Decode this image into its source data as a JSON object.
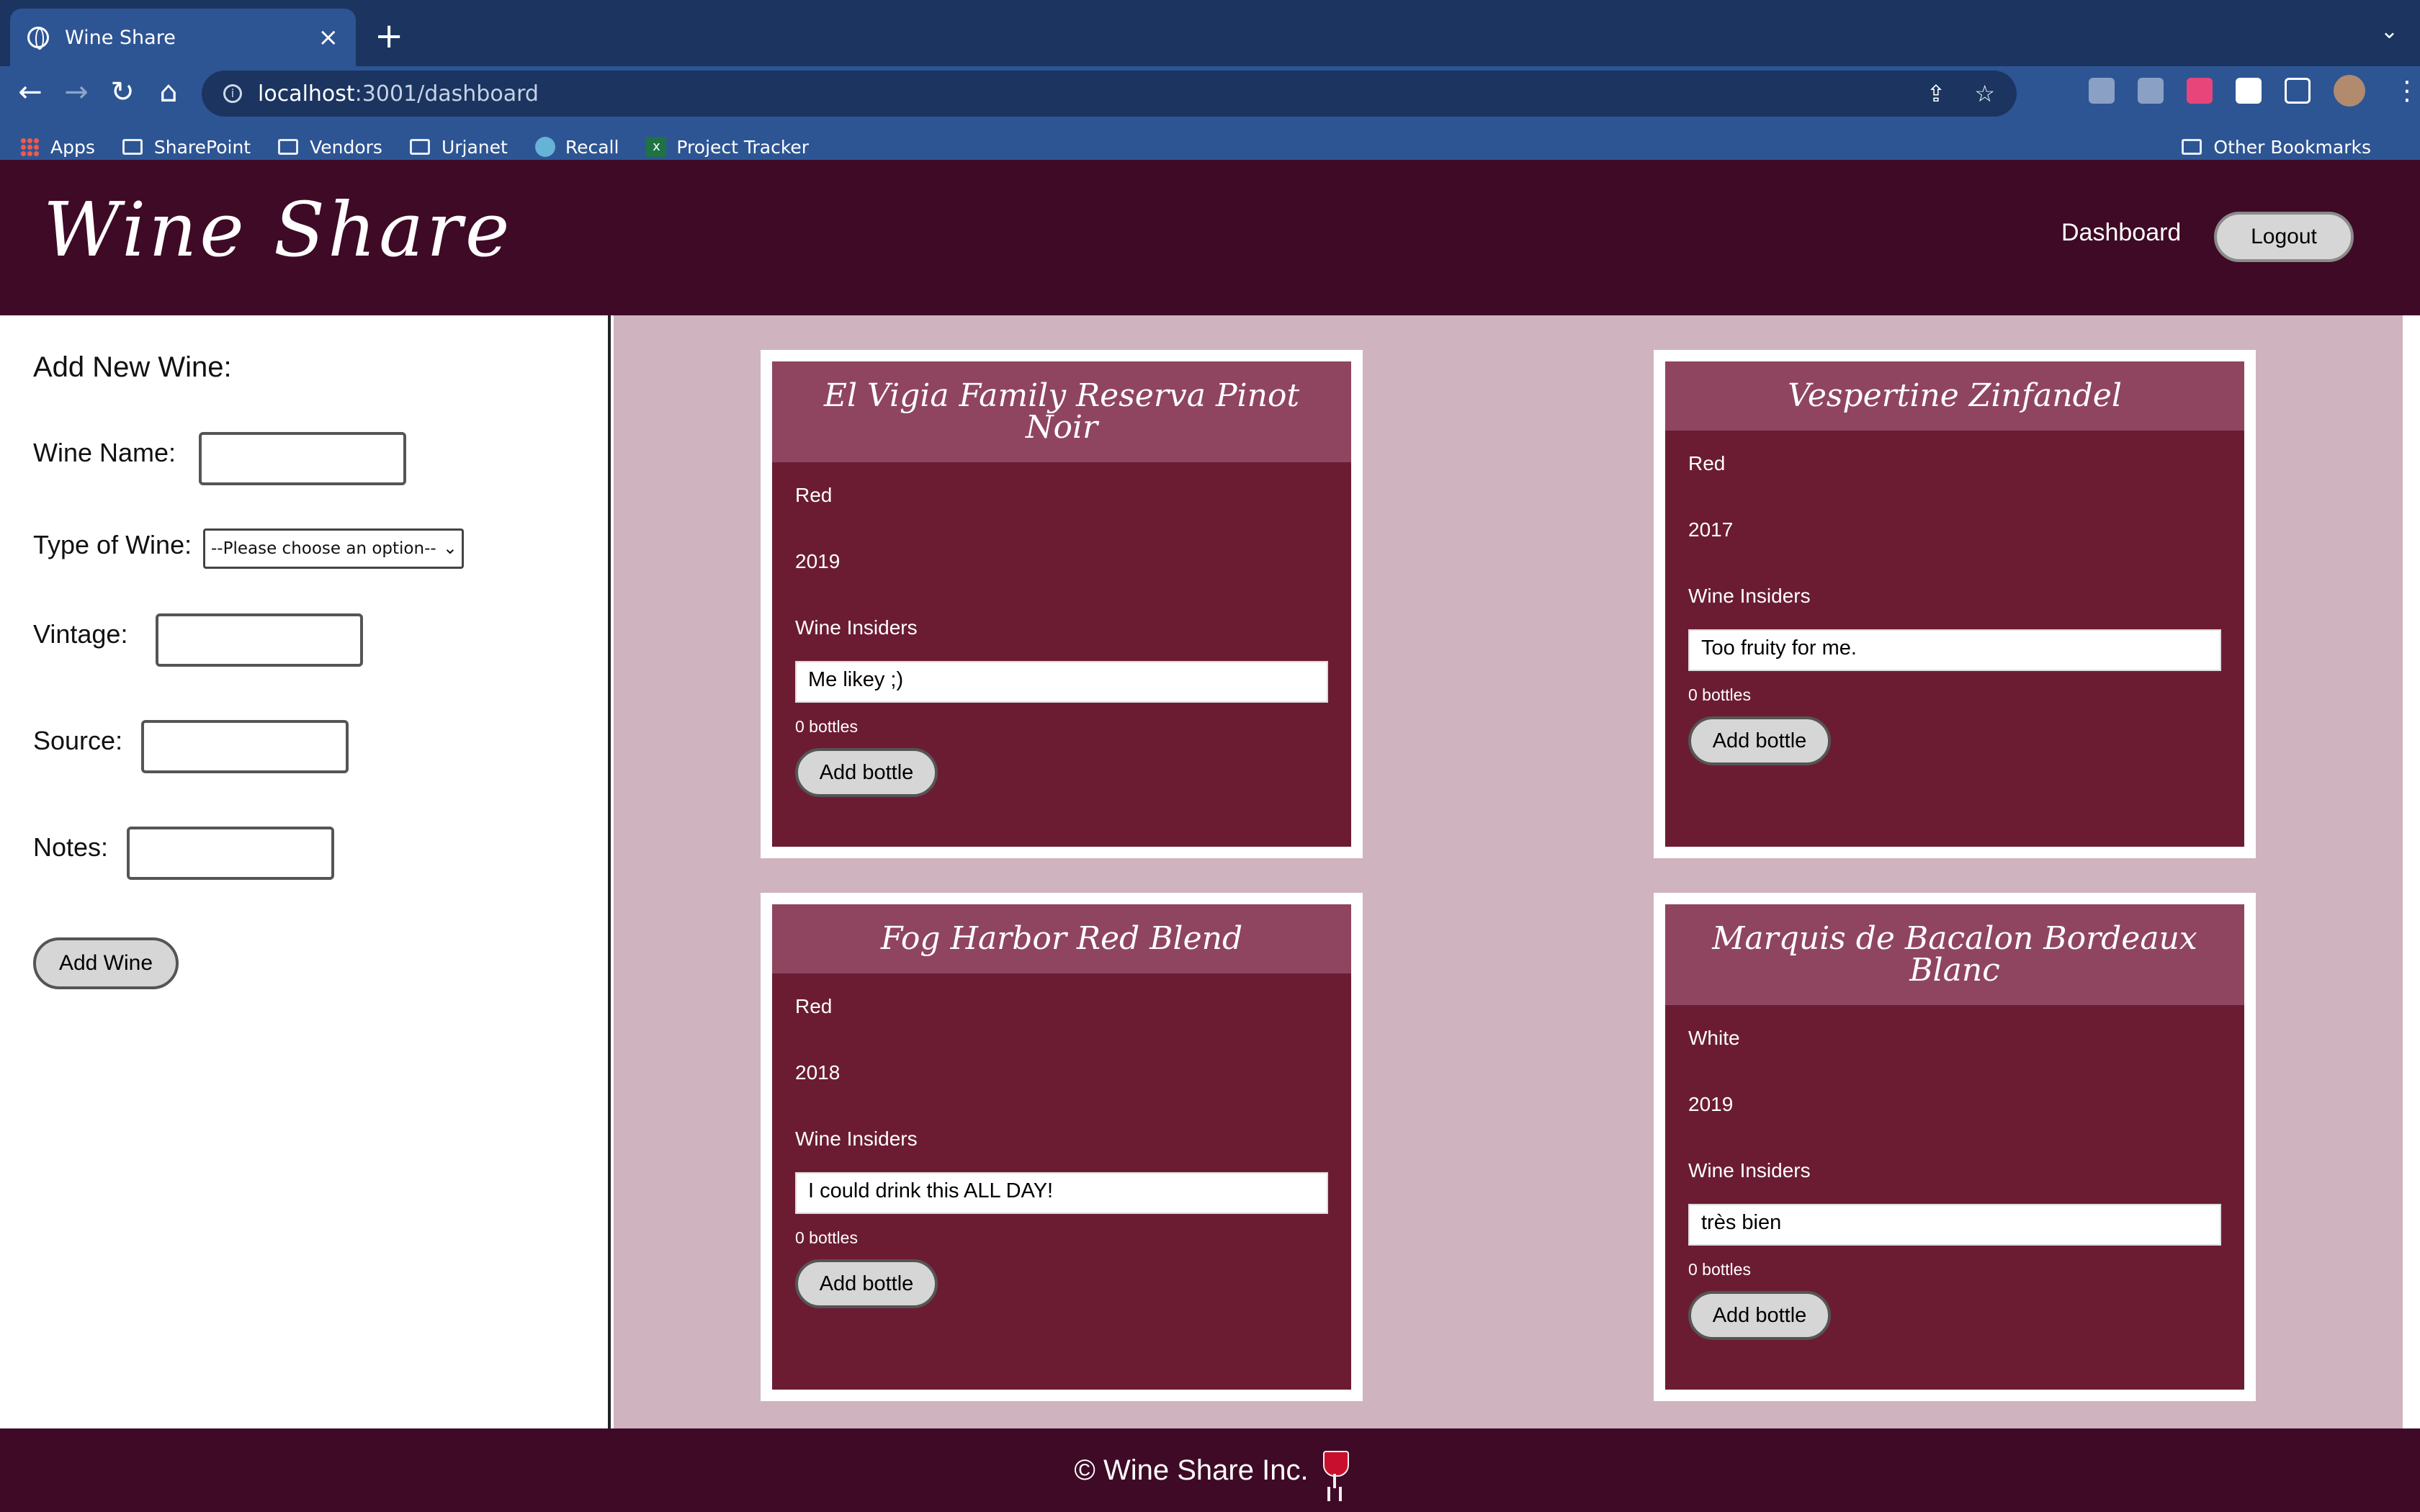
{
  "browser": {
    "tab_title": "Wine Share",
    "url_host": "localhost",
    "url_path": ":3001/dashboard",
    "bookmarks": [
      "Apps",
      "SharePoint",
      "Vendors",
      "Urjanet",
      "Recall",
      "Project Tracker"
    ],
    "other_bookmarks": "Other Bookmarks"
  },
  "header": {
    "logo": "Wine Share",
    "nav_dashboard": "Dashboard",
    "logout_label": "Logout"
  },
  "form": {
    "title": "Add New Wine:",
    "wine_name_label": "Wine Name:",
    "wine_name_value": "",
    "type_label": "Type of Wine:",
    "type_value": "--Please choose an option--",
    "vintage_label": "Vintage:",
    "vintage_value": "",
    "source_label": "Source:",
    "source_value": "",
    "notes_label": "Notes:",
    "notes_value": "",
    "submit_label": "Add Wine"
  },
  "wines": [
    {
      "name": "El Vigia Family Reserva Pinot Noir",
      "type": "Red",
      "vintage": "2019",
      "source": "Wine Insiders",
      "notes": "Me likey ;)",
      "bottles": "0 bottles",
      "button": "Add bottle"
    },
    {
      "name": "Vespertine Zinfandel",
      "type": "Red",
      "vintage": "2017",
      "source": "Wine Insiders",
      "notes": "Too fruity for me.",
      "bottles": "0 bottles",
      "button": "Add bottle"
    },
    {
      "name": "Fog Harbor Red Blend",
      "type": "Red",
      "vintage": "2018",
      "source": "Wine Insiders",
      "notes": "I could drink this ALL DAY!",
      "bottles": "0 bottles",
      "button": "Add bottle"
    },
    {
      "name": "Marquis de Bacalon Bordeaux Blanc",
      "type": "White",
      "vintage": "2019",
      "source": "Wine Insiders",
      "notes": "très bien",
      "bottles": "0 bottles",
      "button": "Add bottle"
    }
  ],
  "footer": {
    "text": "© Wine Share Inc."
  },
  "colors": {
    "header_bg": "#3f0a26",
    "main_bg": "#cfb3bf",
    "card_bg": "#6b1c33",
    "card_head_bg": "#8f4560"
  }
}
